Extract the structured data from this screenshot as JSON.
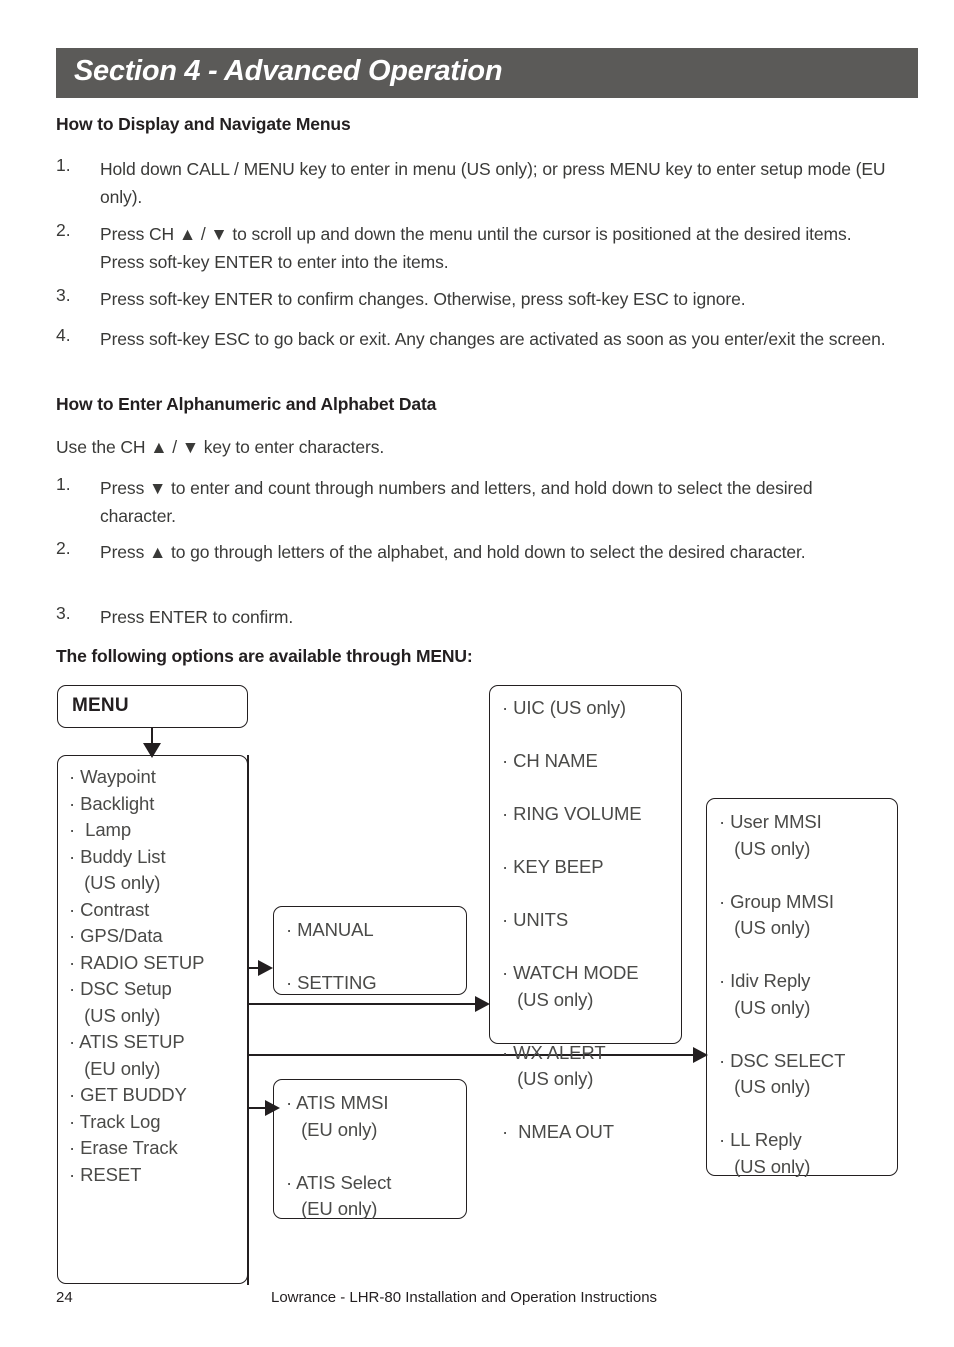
{
  "header": {
    "title": "Section 4 - Advanced Operation",
    "background": "#5b5a58",
    "text_color": "#ffffff"
  },
  "sections": [
    {
      "heading": "How to Display and Navigate Menus",
      "steps": [
        {
          "number": "1.",
          "text": "Hold down CALL / MENU key to enter in menu (US only); or press MENU key to enter setup mode (EU only)."
        },
        {
          "number": "2.",
          "text": "Press CH ▲ / ▼ to scroll up and down the menu until the cursor is positioned at the desired items. Press soft-key ENTER to enter into the items."
        },
        {
          "number": "3.",
          "text": "Press soft-key ENTER to confirm changes. Otherwise, press soft-key ESC to ignore."
        },
        {
          "number": "4.",
          "text": "Press soft-key ESC to go back or exit. Any changes are activated as soon as you enter/exit the screen."
        }
      ]
    },
    {
      "heading": "How to Enter Alphanumeric and Alphabet Data",
      "intro": "Use the CH ▲ / ▼ key to enter characters.",
      "steps": [
        {
          "number": "1.",
          "text": "Press ▼ to enter and count through numbers and letters, and hold down to select the desired character."
        },
        {
          "number": "2.",
          "text": "Press ▲ to go through letters of the alphabet, and hold down to select the desired character."
        },
        {
          "number": "3.",
          "text": "Press ENTER to confirm."
        }
      ]
    }
  ],
  "diagram": {
    "heading": "The following options are available through MENU:",
    "menu_box": {
      "label": "MENU"
    },
    "main_menu_box": {
      "items": [
        "· Waypoint",
        "· Backlight",
        "·  Lamp",
        "· Buddy List",
        "   (US only)",
        "· Contrast",
        "· GPS/Data",
        "· RADIO SETUP",
        "· DSC Setup",
        "   (US only)",
        "· ATIS SETUP",
        "   (EU only)",
        "· GET BUDDY",
        "· Track Log",
        "· Erase Track",
        "· RESET"
      ]
    },
    "gps_data_box": {
      "items": [
        "· MANUAL",
        "",
        "· SETTING"
      ]
    },
    "atis_box": {
      "items": [
        "· ATIS MMSI",
        "   (EU only)",
        "",
        "· ATIS Select",
        "   (EU only)"
      ]
    },
    "radio_setup_box": {
      "items": [
        "· UIC (US only)",
        "",
        "· CH NAME",
        "",
        "· RING VOLUME",
        "",
        "· KEY BEEP",
        "",
        "· UNITS",
        "",
        "· WATCH MODE",
        "   (US only)",
        "",
        "· WX ALERT",
        "   (US only)",
        "",
        "·  NMEA OUT"
      ]
    },
    "dsc_setup_box": {
      "items": [
        "· User MMSI",
        "   (US only)",
        "",
        "· Group MMSI",
        "   (US only)",
        "",
        "· Idiv Reply",
        "   (US only)",
        "",
        "· DSC SELECT",
        "   (US only)",
        "",
        "· LL Reply",
        "   (US only)"
      ]
    }
  },
  "footer": {
    "page_number": "24",
    "text": "Lowrance - LHR-80 Installation and Operation Instructions"
  }
}
